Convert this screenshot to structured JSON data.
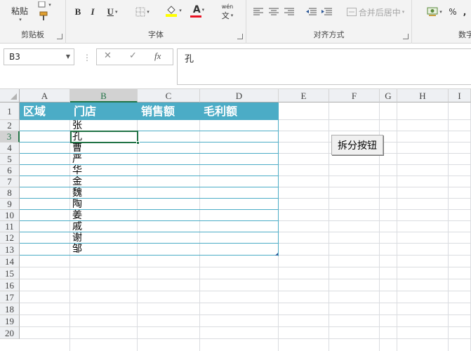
{
  "ribbon": {
    "clipboard": {
      "paste_label": "粘贴",
      "group_label": "剪贴板"
    },
    "font": {
      "bold": "B",
      "italic": "I",
      "underline": "U",
      "font_color_glyph": "A",
      "phonetic_top": "wén",
      "phonetic_bottom": "文",
      "group_label": "字体"
    },
    "alignment": {
      "merge_label": "合并后居中",
      "group_label": "对齐方式"
    },
    "number": {
      "percent": "%",
      "comma": ",",
      "group_label": "数字"
    }
  },
  "formula_bar": {
    "name_box": "B3",
    "fx": "fx",
    "content": "孔"
  },
  "sheet": {
    "columns": [
      "A",
      "B",
      "C",
      "D",
      "E",
      "F",
      "G",
      "H",
      "I"
    ],
    "rows": [
      "1",
      "2",
      "3",
      "4",
      "5",
      "6",
      "7",
      "8",
      "9",
      "10",
      "11",
      "12",
      "13",
      "14",
      "15",
      "16",
      "17",
      "18",
      "19",
      "20"
    ],
    "selected_column": "B",
    "selected_row": "3",
    "headers": [
      "区域",
      "门店",
      "销售额",
      "毛利额"
    ],
    "stores": [
      "张",
      "孔",
      "曹",
      "严",
      "华",
      "金",
      "魏",
      "陶",
      "姜",
      "戚",
      "谢",
      "邹"
    ]
  },
  "button": {
    "label": "拆分按钮"
  },
  "colors": {
    "table_header": "#4bacc6",
    "selection": "#217346"
  }
}
